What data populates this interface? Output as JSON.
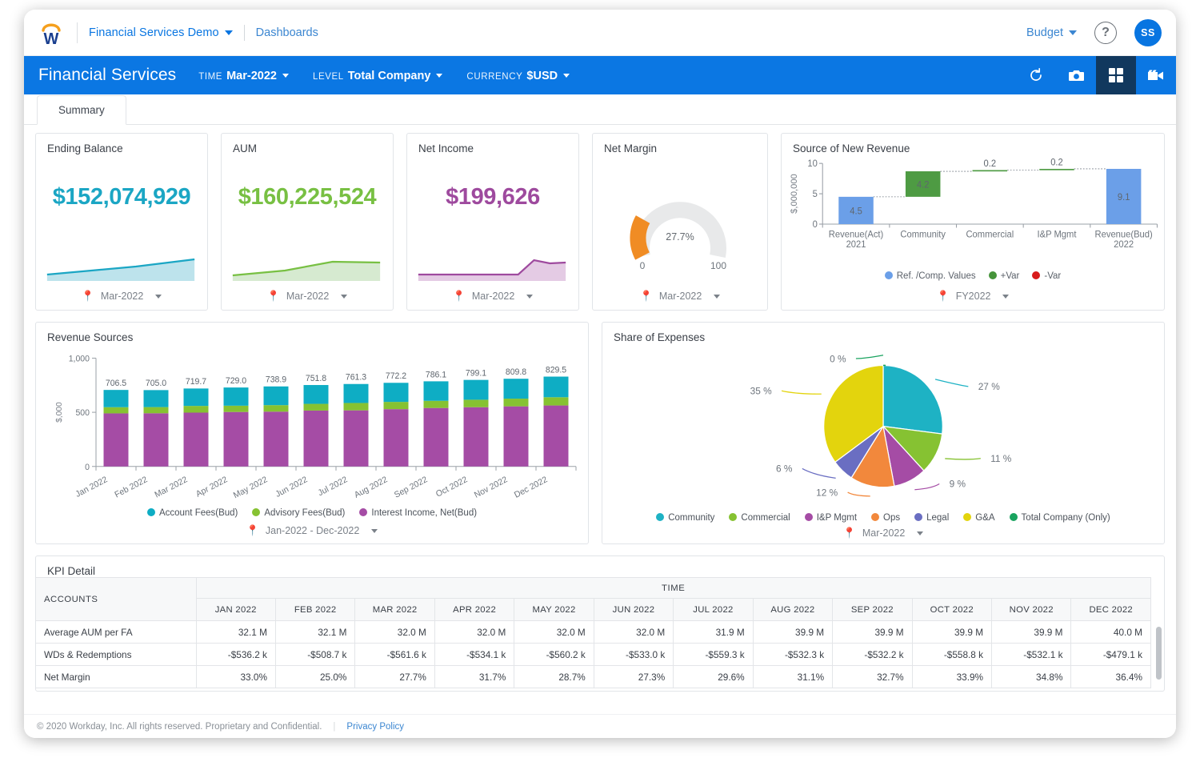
{
  "header": {
    "logo_icon": "workday-w-logo",
    "tenant": "Financial Services Demo",
    "breadcrumb": "Dashboards",
    "budget_menu": "Budget",
    "help_icon": "question-mark-icon",
    "avatar_initials": "SS"
  },
  "toolbar": {
    "title": "Financial Services",
    "filters": [
      {
        "label": "TIME",
        "value": "Mar-2022"
      },
      {
        "label": "LEVEL",
        "value": "Total Company"
      },
      {
        "label": "CURRENCY",
        "value": "$USD"
      }
    ],
    "actions": [
      {
        "name": "refresh-icon",
        "active": false
      },
      {
        "name": "camera-icon",
        "active": false
      },
      {
        "name": "grid-icon",
        "active": true
      },
      {
        "name": "video-icon",
        "active": false
      }
    ]
  },
  "tabs": [
    {
      "label": "Summary",
      "active": true
    }
  ],
  "kpis": [
    {
      "title": "Ending Balance",
      "value": "$152,074,929",
      "color": "#1ba6c4",
      "fill": "#bde3ec",
      "period": "Mar-2022"
    },
    {
      "title": "AUM",
      "value": "$160,225,524",
      "color": "#78c043",
      "fill": "#d6ead0",
      "period": "Mar-2022"
    },
    {
      "title": "Net Income",
      "value": "$199,626",
      "color": "#9e4a9e",
      "fill": "#e4cbe4",
      "period": "Mar-2022"
    }
  ],
  "net_margin": {
    "title": "Net Margin",
    "value_label": "27.7%",
    "min_label": "0",
    "max_label": "100",
    "period": "Mar-2022",
    "gauge_color": "#f08c24",
    "track_color": "#e8e9ea"
  },
  "chart_data": [
    {
      "id": "source-of-new-revenue",
      "type": "bar",
      "title": "Source of New Revenue",
      "subtype": "waterfall",
      "categories": [
        "Revenue(Act) 2021",
        "Community",
        "Commercial",
        "I&P Mgmt",
        "Revenue(Bud) 2022"
      ],
      "category_lines": [
        [
          "Revenue(Act)",
          "2021"
        ],
        [
          "Community"
        ],
        [
          "Commercial"
        ],
        [
          "I&P Mgmt"
        ],
        [
          "Revenue(Bud)",
          "2022"
        ]
      ],
      "values": [
        4.5,
        4.2,
        0.2,
        0.2,
        9.1
      ],
      "value_labels": [
        "4.5",
        "4.2",
        "0.2",
        "0.2",
        "9.1"
      ],
      "bar_types": [
        "total",
        "increase",
        "increase",
        "increase",
        "total"
      ],
      "bases": [
        0,
        4.5,
        8.7,
        8.9,
        0
      ],
      "ylabel": "$,000,000",
      "yticks": [
        0,
        5,
        10
      ],
      "ytick_labels": [
        "0",
        "5",
        "10"
      ],
      "ylim": [
        0,
        10
      ],
      "legend": [
        {
          "label": "Ref. /Comp. Values",
          "color": "#6b9fe8"
        },
        {
          "label": "+Var",
          "color": "#45933a"
        },
        {
          "label": "-Var",
          "color": "#d81b1b"
        }
      ],
      "legend_position": "bottom",
      "period": "FY2022"
    },
    {
      "id": "revenue-sources",
      "type": "bar",
      "subtype": "stacked",
      "title": "Revenue Sources",
      "categories": [
        "Jan 2022",
        "Feb 2022",
        "Mar 2022",
        "Apr 2022",
        "May 2022",
        "Jun 2022",
        "Jul 2022",
        "Aug 2022",
        "Sep 2022",
        "Oct 2022",
        "Nov 2022",
        "Dec 2022"
      ],
      "totals": [
        706.5,
        705.0,
        719.7,
        729.0,
        738.9,
        751.8,
        761.3,
        772.2,
        786.1,
        799.1,
        809.8,
        829.5
      ],
      "total_labels": [
        "706.5",
        "705.0",
        "719.7",
        "729.0",
        "738.9",
        "751.8",
        "761.3",
        "772.2",
        "786.1",
        "799.1",
        "809.8",
        "829.5"
      ],
      "series": [
        {
          "name": "Interest Income, Net(Bud)",
          "color": "#a54ca5",
          "values": [
            490,
            491,
            497,
            503,
            506,
            516,
            518,
            529,
            540,
            547,
            555,
            563
          ]
        },
        {
          "name": "Advisory Fees(Bud)",
          "color": "#86c232",
          "values": [
            57,
            57,
            62,
            58,
            60,
            62,
            68,
            67,
            66,
            69,
            71,
            76
          ]
        },
        {
          "name": "Account Fees(Bud)",
          "color": "#0eadc4",
          "values": [
            159.5,
            157,
            160.7,
            168,
            172.9,
            173.8,
            175.3,
            176.2,
            180.1,
            183.1,
            183.8,
            190.5
          ]
        }
      ],
      "legend": [
        {
          "label": "Account Fees(Bud)",
          "color": "#0eadc4"
        },
        {
          "label": "Advisory Fees(Bud)",
          "color": "#86c232"
        },
        {
          "label": "Interest Income, Net(Bud)",
          "color": "#a54ca5"
        }
      ],
      "legend_position": "bottom",
      "ylabel": "$,000",
      "yticks": [
        0,
        500,
        1000
      ],
      "ytick_labels": [
        "0",
        "500",
        "1,000"
      ],
      "ylim": [
        0,
        1000
      ],
      "period": "Jan-2022 - Dec-2022"
    },
    {
      "id": "share-of-expenses",
      "type": "pie",
      "title": "Share of Expenses",
      "labels": [
        "Community",
        "Commercial",
        "I&P Mgmt",
        "Ops",
        "Legal",
        "G&A",
        "Total Company (Only)"
      ],
      "values": [
        27,
        11,
        9,
        12,
        6,
        35,
        0
      ],
      "value_labels": [
        "27 %",
        "11 %",
        "9 %",
        "12 %",
        "6 %",
        "35 %",
        "0 %"
      ],
      "colors": [
        "#1eb2c4",
        "#86c232",
        "#a54ca5",
        "#f2883c",
        "#6a6ec2",
        "#e3d40d",
        "#19a35f"
      ],
      "legend": [
        {
          "label": "Community",
          "color": "#1eb2c4"
        },
        {
          "label": "Commercial",
          "color": "#86c232"
        },
        {
          "label": "I&P Mgmt",
          "color": "#a54ca5"
        },
        {
          "label": "Ops",
          "color": "#f2883c"
        },
        {
          "label": "Legal",
          "color": "#6a6ec2"
        },
        {
          "label": "G&A",
          "color": "#e3d40d"
        },
        {
          "label": "Total Company (Only)",
          "color": "#19a35f"
        }
      ],
      "legend_position": "bottom",
      "period": "Mar-2022"
    }
  ],
  "kpi_detail": {
    "title": "KPI Detail",
    "corner_header": "ACCOUNTS",
    "group_header": "TIME",
    "columns": [
      "JAN 2022",
      "FEB 2022",
      "MAR 2022",
      "APR 2022",
      "MAY 2022",
      "JUN 2022",
      "JUL 2022",
      "AUG 2022",
      "SEP 2022",
      "OCT 2022",
      "NOV 2022",
      "DEC 2022"
    ],
    "rows": [
      {
        "label": "Average AUM per FA",
        "cells": [
          "32.1 M",
          "32.1 M",
          "32.0 M",
          "32.0 M",
          "32.0 M",
          "32.0 M",
          "31.9 M",
          "39.9 M",
          "39.9 M",
          "39.9 M",
          "39.9 M",
          "40.0 M"
        ]
      },
      {
        "label": "WDs & Redemptions",
        "cells": [
          "-$536.2 k",
          "-$508.7 k",
          "-$561.6 k",
          "-$534.1 k",
          "-$560.2 k",
          "-$533.0 k",
          "-$559.3 k",
          "-$532.3 k",
          "-$532.2 k",
          "-$558.8 k",
          "-$532.1 k",
          "-$479.1 k"
        ]
      },
      {
        "label": "Net Margin",
        "cells": [
          "33.0%",
          "25.0%",
          "27.7%",
          "31.7%",
          "28.7%",
          "27.3%",
          "29.6%",
          "31.1%",
          "32.7%",
          "33.9%",
          "34.8%",
          "36.4%"
        ]
      }
    ]
  },
  "footer": {
    "copyright": "© 2020 Workday, Inc. All rights reserved. Proprietary and Confidential.",
    "privacy_link": "Privacy Policy"
  }
}
